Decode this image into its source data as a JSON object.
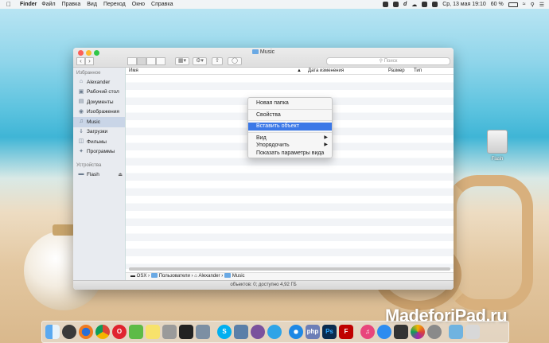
{
  "menubar": {
    "app_name": "Finder",
    "items": [
      "Файл",
      "Правка",
      "Вид",
      "Переход",
      "Окно",
      "Справка"
    ],
    "clock": "Ср, 13 мая  19:10",
    "battery": "60 %"
  },
  "window": {
    "title": "Music",
    "search_placeholder": "Поиск",
    "columns": {
      "name": "Имя",
      "date": "Дата изменения",
      "size": "Размер",
      "kind": "Тип"
    },
    "status": "объектов: 0; доступно 4,92 ГБ"
  },
  "sidebar": {
    "favorites_header": "Избранное",
    "favorites": [
      {
        "label": "Alexander",
        "icon": "home-icon"
      },
      {
        "label": "Рабочий стол",
        "icon": "desktop-icon"
      },
      {
        "label": "Документы",
        "icon": "documents-icon"
      },
      {
        "label": "Изображения",
        "icon": "camera-icon"
      },
      {
        "label": "Music",
        "icon": "music-note-icon"
      },
      {
        "label": "Загрузки",
        "icon": "downloads-icon"
      },
      {
        "label": "Фильмы",
        "icon": "film-icon"
      },
      {
        "label": "Программы",
        "icon": "applications-icon"
      }
    ],
    "devices_header": "Устройства",
    "devices": [
      {
        "label": "Flash",
        "icon": "drive-icon"
      }
    ]
  },
  "pathbar": [
    "OSX",
    "Пользователи",
    "Alexander",
    "Music"
  ],
  "context_menu": {
    "new_folder": "Новая папка",
    "properties": "Свойства",
    "paste": "Вставить объект",
    "view": "Вид",
    "arrange": "Упорядочить",
    "view_options": "Показать параметры вида"
  },
  "desktop": {
    "disk_label": "Flash"
  },
  "watermark": "MadeforiPad.ru",
  "colors": {
    "selection": "#3b78e7",
    "sidebar_bg": "#e8ebf0",
    "close": "#fc5f57",
    "minimize": "#fdbb2e",
    "maximize": "#32c748"
  }
}
